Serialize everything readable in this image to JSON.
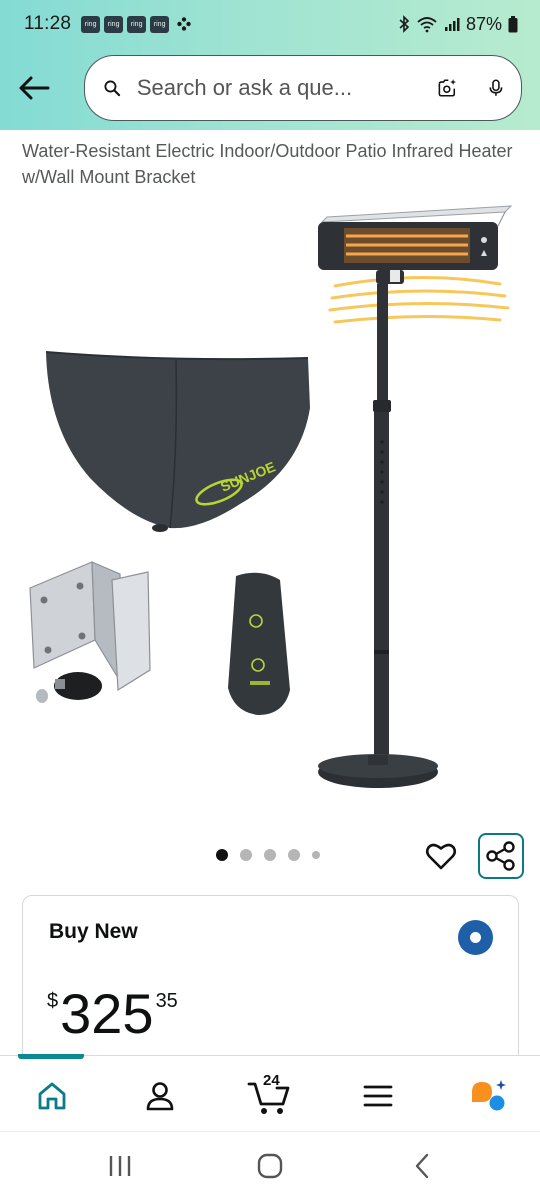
{
  "status_bar": {
    "time": "11:28",
    "notification_badges": [
      "ring",
      "ring",
      "ring",
      "ring"
    ],
    "battery": "87%"
  },
  "search": {
    "placeholder": "Search or ask a que..."
  },
  "product": {
    "title": "Water-Resistant Electric Indoor/Outdoor Patio Infrared Heater w/Wall Mount Bracket",
    "image_brand_text": "SUNJOE",
    "image_count": 5,
    "active_image_index": 0
  },
  "buy_box": {
    "label": "Buy New",
    "currency_symbol": "$",
    "price_whole": "325",
    "price_fraction": "35",
    "selected": true
  },
  "bottom_nav": {
    "items": [
      "home-icon",
      "account-icon",
      "cart-icon",
      "menu-icon",
      "rufus-icon"
    ],
    "cart_count": "24",
    "active": "home"
  },
  "colors": {
    "header_gradient_start": "#83dbd4",
    "header_gradient_end": "#b7ebcf",
    "accent_teal": "#0a7a82",
    "radio_blue": "#1e5fa8"
  }
}
